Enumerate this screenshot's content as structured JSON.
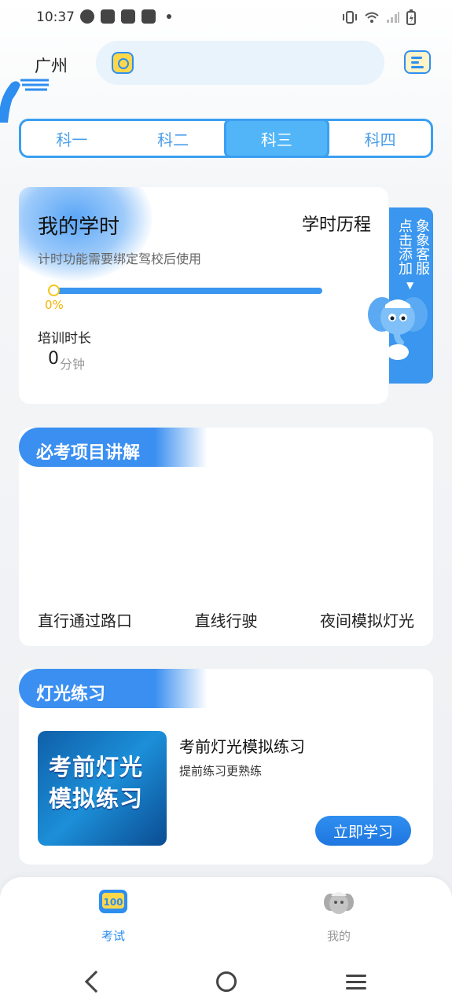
{
  "status_bar": {
    "time": "10:37"
  },
  "header": {
    "city": "广州",
    "search_placeholder": ""
  },
  "tabs": [
    {
      "label": "科一",
      "active": false
    },
    {
      "label": "科二",
      "active": false
    },
    {
      "label": "科三",
      "active": true
    },
    {
      "label": "科四",
      "active": false
    }
  ],
  "study_hours": {
    "title": "我的学时",
    "history_link": "学时历程",
    "subtitle": "计时功能需要绑定驾校后使用",
    "progress": 0,
    "progress_label": "0%",
    "training_label": "培训时长",
    "training_value": "0",
    "training_unit": "分钟"
  },
  "side_tab": {
    "col1": "点击添加",
    "col2": "象象客服",
    "arrow": "▼"
  },
  "exam_items": {
    "title": "必考项目讲解",
    "items": [
      "直行通过路口",
      "直线行驶",
      "夜间模拟灯光"
    ]
  },
  "light_practice": {
    "title": "灯光练习",
    "thumb_line1": "考前灯光",
    "thumb_line2": "模拟练习",
    "card_title": "考前灯光模拟练习",
    "card_subtitle": "提前练习更熟练",
    "button": "立即学习"
  },
  "bottom_nav": [
    {
      "label": "考试",
      "icon": "exam-100-icon",
      "active": true,
      "color": "#2e8ef0"
    },
    {
      "label": "我的",
      "icon": "elephant-avatar-icon",
      "active": false,
      "color": "#999999"
    }
  ],
  "colors": {
    "accent": "#3a96ee",
    "progress_knob": "#f5c518"
  }
}
